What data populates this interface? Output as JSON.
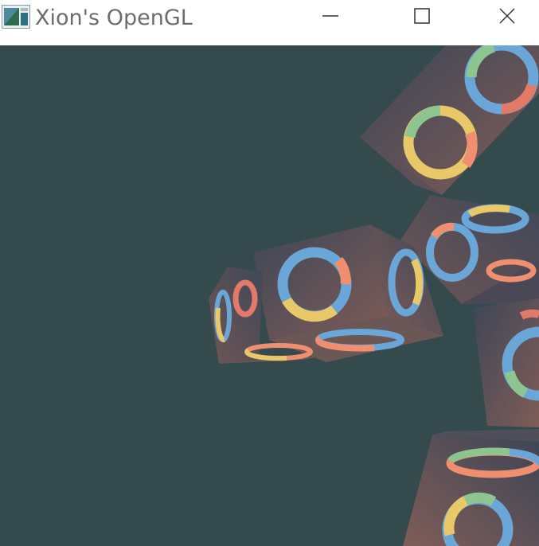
{
  "window": {
    "title": "Xion's OpenGL",
    "icon": "opengl-app-icon",
    "controls": [
      "minimize-icon",
      "maximize-icon",
      "close-icon"
    ]
  },
  "scene": {
    "clear_color": "#344a4d",
    "cube_face_gradient": [
      "#3f4656",
      "#7d5a56"
    ],
    "ring_palette": [
      "#6aa7d8",
      "#8cc58f",
      "#e8c868",
      "#f08f6f",
      "#e27a6a"
    ],
    "visible_cube_count": 6
  }
}
